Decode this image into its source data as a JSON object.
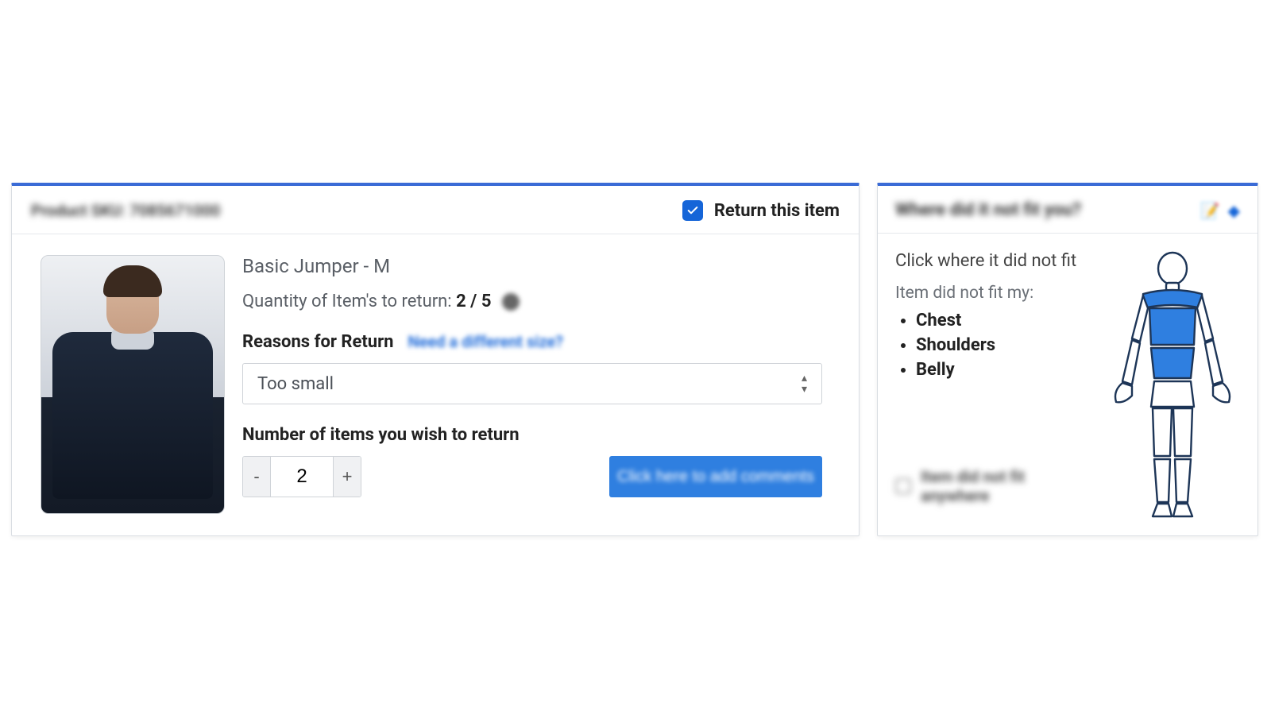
{
  "left": {
    "sku_label": "Product SKU: 7085671000",
    "return_toggle_label": "Return this item",
    "return_checked": true,
    "product_name": "Basic Jumper - M",
    "qty_label_prefix": "Quantity of Item's to return: ",
    "qty_value": "2 / 5",
    "reasons_label": "Reasons for Return",
    "different_size_link": "Need a different size?",
    "reason_selected": "Too small",
    "number_label": "Number of items you wish to return",
    "stepper_value": "2",
    "minus": "-",
    "plus": "+",
    "comments_button": "Click here to add comments"
  },
  "right": {
    "header_title": "Where did it not fit you?",
    "click_title": "Click where it did not fit",
    "fit_label": "Item did not fit my:",
    "areas": [
      "Chest",
      "Shoulders",
      "Belly"
    ],
    "anywhere_label": "Item did not fit anywhere"
  }
}
